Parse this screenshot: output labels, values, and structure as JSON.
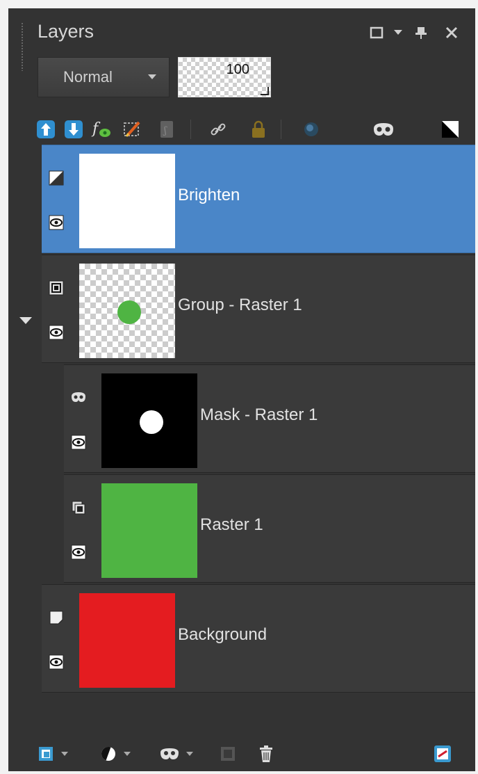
{
  "panel": {
    "title": "Layers",
    "blend_mode": "Normal",
    "opacity": "100"
  },
  "layers": [
    {
      "name": "Brighten",
      "type": "adjustment",
      "selected": true
    },
    {
      "name": "Group - Raster 1",
      "type": "group",
      "expanded": true
    },
    {
      "name": "Mask - Raster 1",
      "type": "mask"
    },
    {
      "name": "Raster 1",
      "type": "raster"
    },
    {
      "name": "Background",
      "type": "background"
    }
  ],
  "colors": {
    "selected_row": "#4a86c8",
    "green_layer": "#4fb443",
    "red_layer": "#e41c20",
    "panel_bg": "#333333"
  },
  "icons": {
    "title_bar": [
      "maximize-icon",
      "menu-dropdown-icon",
      "pin-icon",
      "close-icon"
    ],
    "toolbar": [
      "move-layer-up-icon",
      "move-layer-down-icon",
      "layer-styles-icon",
      "edit-selection-icon",
      "lock-transparency-icon",
      "link-icon",
      "lock-icon",
      "highlight-icon",
      "mask-icon",
      "adjustment-contrast-icon"
    ],
    "bottom": [
      "new-raster-layer-icon",
      "new-adjustment-layer-icon",
      "new-mask-icon",
      "merge-icon",
      "delete-icon",
      "layer-properties-icon"
    ]
  }
}
